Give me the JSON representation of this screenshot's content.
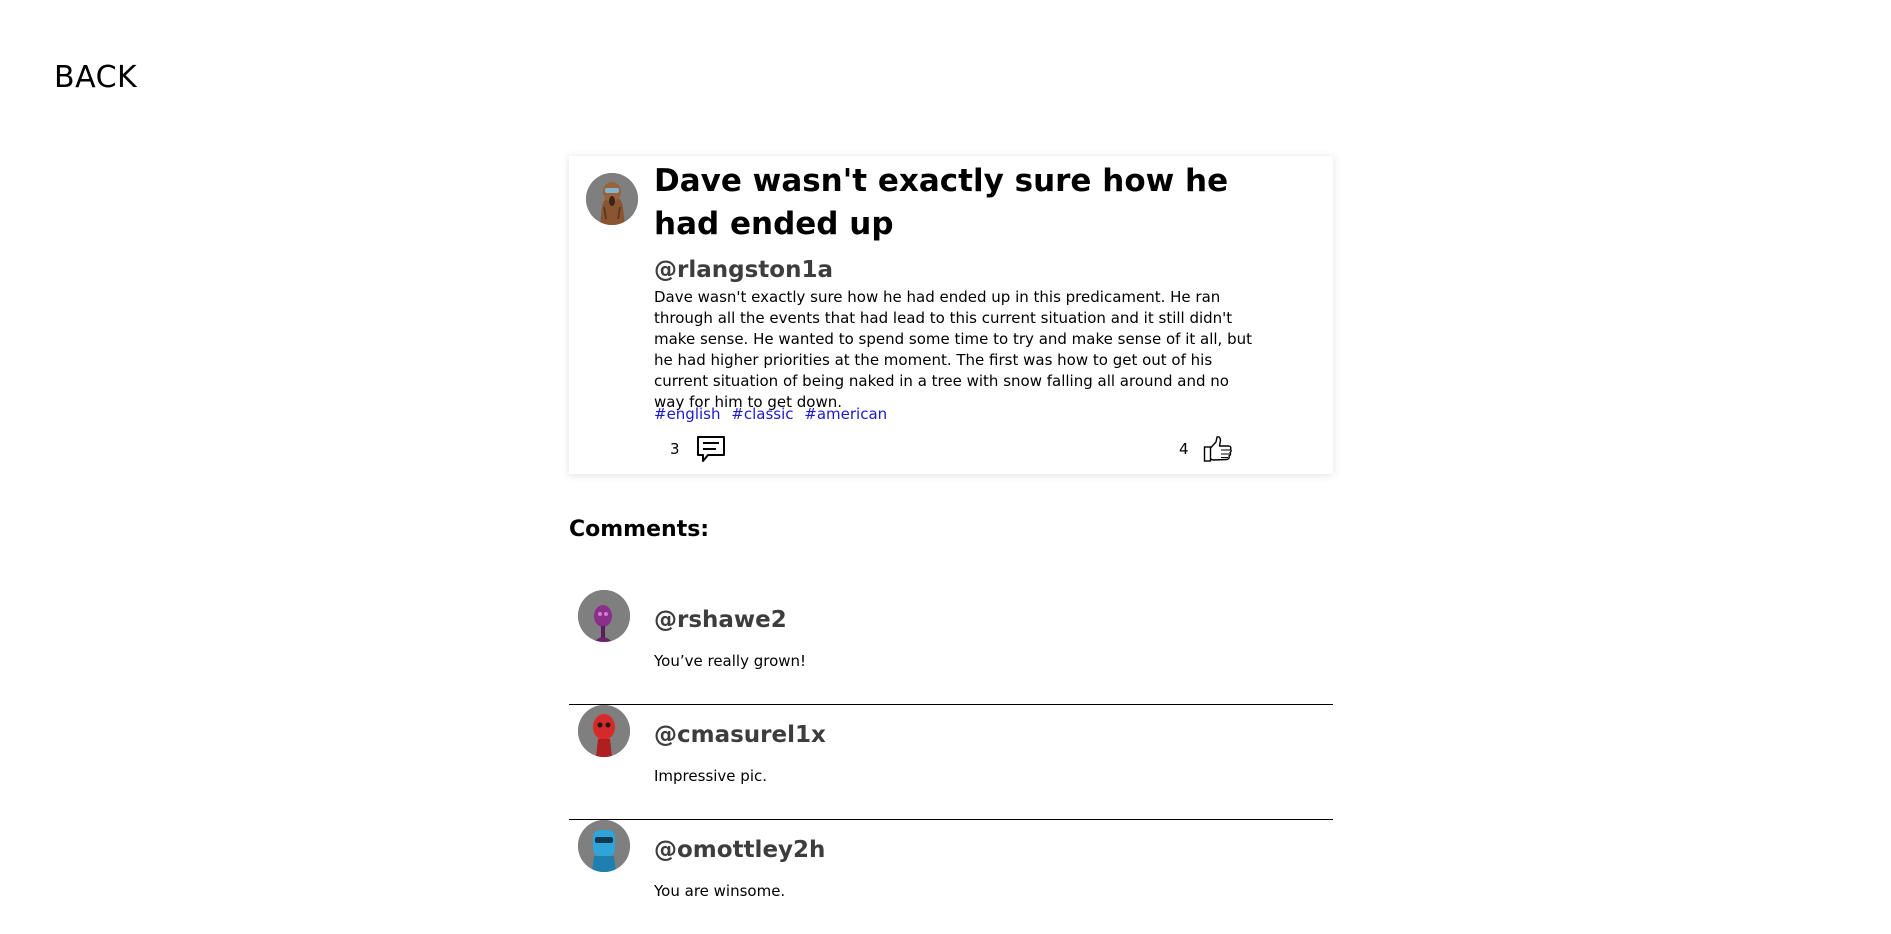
{
  "nav": {
    "back_label": "BACK"
  },
  "post": {
    "title": "Dave wasn't exactly sure how he had ended up",
    "author": "@rlangston1a",
    "body": "Dave wasn't exactly sure how he had ended up in this predicament. He ran through all the events that had lead to this current situation and it still didn't make sense. He wanted to spend some time to try and make sense of it all, but he had higher priorities at the moment. The first was how to get out of his current situation of being naked in a tree with snow falling all around and no way for him to get down.",
    "tags": [
      "#english",
      "#classic",
      "#american"
    ],
    "comment_count": "3",
    "like_count": "4"
  },
  "comments_section": {
    "heading": "Comments:",
    "items": [
      {
        "author": "@rshawe2",
        "text": "You’ve really grown!"
      },
      {
        "author": "@cmasurel1x",
        "text": "Impressive pic."
      },
      {
        "author": "@omottley2h",
        "text": "You are winsome."
      }
    ]
  }
}
